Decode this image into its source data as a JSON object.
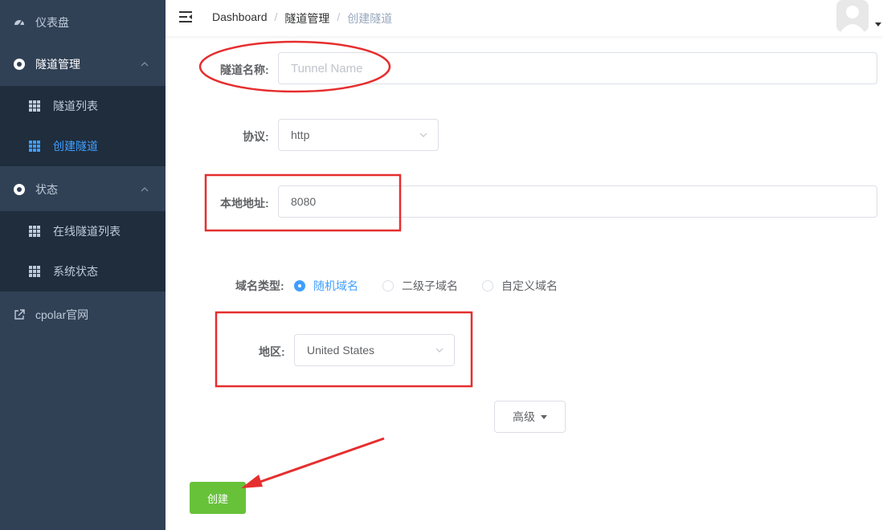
{
  "colors": {
    "sidebar": "#304156",
    "submenu": "#1f2d3d",
    "accent": "#409eff",
    "success": "#67c23a",
    "annotation": "#e62e2e"
  },
  "sidebar": {
    "items": [
      {
        "label": "仪表盘",
        "icon": "dashboard-icon"
      },
      {
        "label": "隧道管理",
        "icon": "tunnel-icon",
        "children": [
          {
            "label": "隧道列表",
            "icon": "table-icon"
          },
          {
            "label": "创建隧道",
            "icon": "table-icon",
            "active": true
          }
        ]
      },
      {
        "label": "状态",
        "icon": "status-icon",
        "children": [
          {
            "label": "在线隧道列表",
            "icon": "table-icon"
          },
          {
            "label": "系统状态",
            "icon": "table-icon"
          }
        ]
      },
      {
        "label": "cpolar官网",
        "icon": "external-link-icon"
      }
    ]
  },
  "header": {
    "breadcrumb": [
      "Dashboard",
      "隧道管理",
      "创建隧道"
    ]
  },
  "form": {
    "name_label": "隧道名称:",
    "name_placeholder": "Tunnel Name",
    "protocol_label": "协议:",
    "protocol_value": "http",
    "local_label": "本地地址:",
    "local_value": "8080",
    "domain_type_label": "域名类型:",
    "domain_options": [
      "随机域名",
      "二级子域名",
      "自定义域名"
    ],
    "domain_selected": "随机域名",
    "region_label": "地区:",
    "region_value": "United States",
    "advanced_label": "高级",
    "create_label": "创建"
  }
}
